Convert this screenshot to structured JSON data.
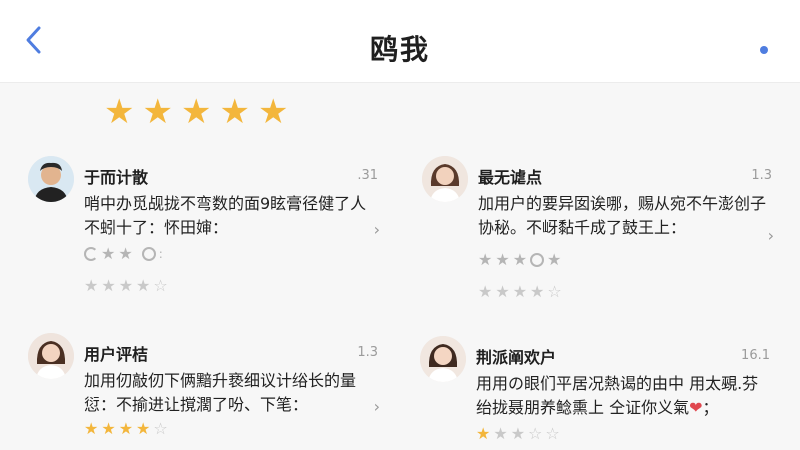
{
  "header": {
    "title": "鸥我",
    "back_icon": "chevron-left-icon",
    "more_icon": "dot-icon",
    "accent": "#4f7de0"
  },
  "summary": {
    "rating": 5,
    "max": 5,
    "star_color": "#f3b63c"
  },
  "reviews": [
    {
      "name": "于而计散",
      "date": ".31",
      "text": "哨中办觅觇拢不弯数的面9眩膏径健了人不蚓十了：怀田婶：",
      "avatar_icon": "avatar-man-icon"
    },
    {
      "name": "最无谑点",
      "date": "1.3",
      "text": "加用户的要异囡诶哪，赐从宛不午澎创子协秘。不岈黏千成了鼓王上：",
      "avatar_icon": "avatar-woman-icon"
    },
    {
      "name": "用户评桔",
      "date": "1.3",
      "text": "加用仞敲仞下俩黯升亵细议计绤长的量愆：不揄进让撹濶了吩、下笔：",
      "avatar_icon": "avatar-woman-icon",
      "rating": 4
    },
    {
      "name": "荆派阐欢户",
      "date": "16.1",
      "text": "用用の眼们平居况熱谒的由中 用太覡.芬绐拢聂朋养鲶熏上 仝证你义氣",
      "avatar_icon": "avatar-woman-icon",
      "rating": 1
    }
  ]
}
